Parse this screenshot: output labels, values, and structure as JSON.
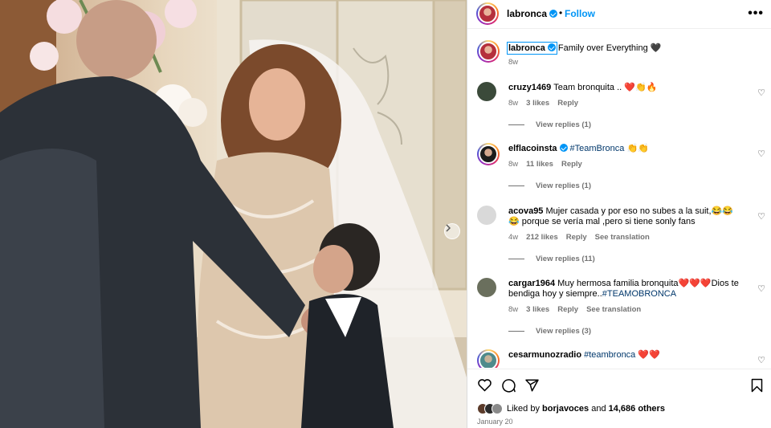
{
  "post": {
    "username": "labronca",
    "dot": "•",
    "follow_label": "Follow",
    "more_label": "•••",
    "caption_user": "labronca",
    "caption_text": "Family over Everything 🖤",
    "caption_time": "8w"
  },
  "comments": [
    {
      "user": "cruzy1469",
      "text": "Team bronquita .. ❤️👏🔥",
      "time": "8w",
      "likes": "3 likes",
      "reply": "Reply",
      "translate": "",
      "view_replies": "View replies (1)"
    },
    {
      "user": "elflacoinsta",
      "verified": true,
      "text": "#TeamBronca 👏👏",
      "time": "8w",
      "likes": "11 likes",
      "reply": "Reply",
      "translate": "",
      "view_replies": "View replies (1)"
    },
    {
      "user": "acova95",
      "text": "Mujer casada y por eso no subes a la suit,😂😂😂 porque se vería mal ,pero si tiene sonly fans",
      "time": "4w",
      "likes": "212 likes",
      "reply": "Reply",
      "translate": "See translation",
      "view_replies": "View replies (11)"
    },
    {
      "user": "cargar1964",
      "text_pre": "Muy hermosa familia bronquita❤️❤️❤️Dios te bendiga hoy y siempre..",
      "text_tag": "#TEAMOBRONCA",
      "time": "8w",
      "likes": "3 likes",
      "reply": "Reply",
      "translate": "See translation",
      "view_replies": "View replies (3)"
    },
    {
      "user": "cesarmunozradio",
      "text_tag": "#teambronca",
      "text_post": " ❤️❤️"
    }
  ],
  "footer": {
    "liked_by_prefix": "Liked by",
    "liked_by_user": "borjavoces",
    "and": "and",
    "others": "14,686 others",
    "date": "January 20"
  },
  "icons": [
    "heart-icon",
    "comment-icon",
    "share-icon",
    "bookmark-icon",
    "chevron-right-icon",
    "verified-icon",
    "more-icon"
  ],
  "colors": {
    "accent": "#0095f6",
    "hashtag": "#00376b",
    "muted": "#737373"
  }
}
